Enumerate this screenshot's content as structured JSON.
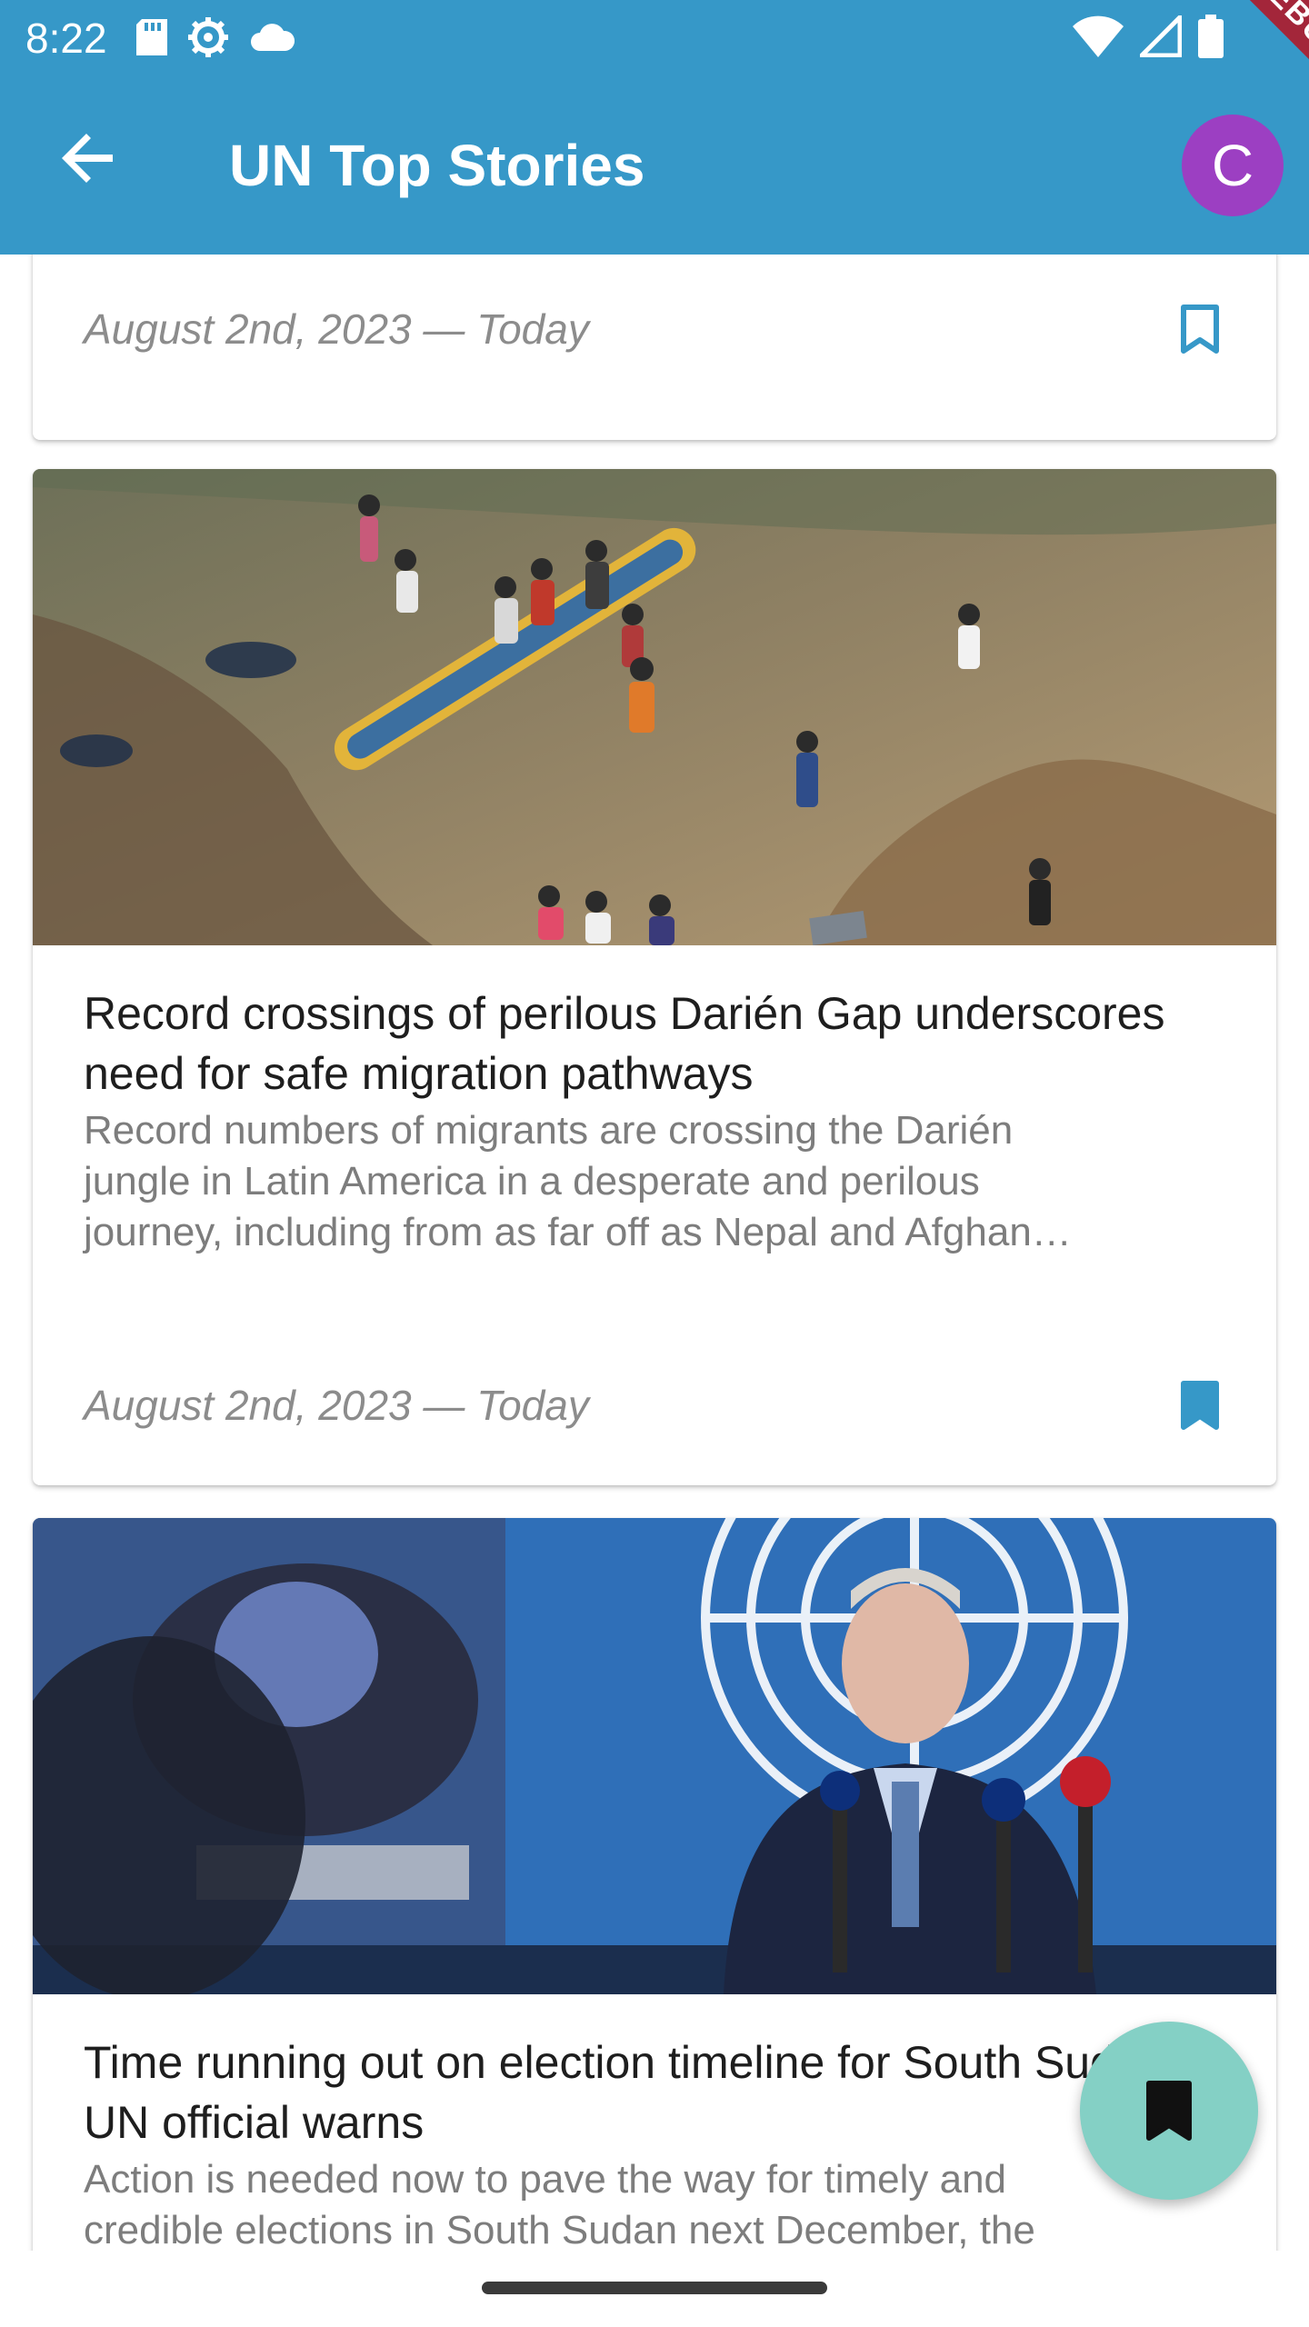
{
  "status_bar": {
    "time": "8:22",
    "left_icons": [
      "sd-card-icon",
      "settings-gear-icon",
      "cloud-icon"
    ],
    "right_icons": [
      "wifi-icon",
      "cell-signal-icon",
      "battery-icon"
    ]
  },
  "debug_banner": "DEBUG",
  "app_bar": {
    "title": "UN Top Stories",
    "avatar_letter": "C",
    "colors": {
      "background": "#3698c8",
      "avatar": "#9c3fc2"
    }
  },
  "stories": [
    {
      "date": "August 2nd, 2023 — Today",
      "bookmarked": false
    },
    {
      "image": "migrants-crossing-river-photo",
      "title": "Record crossings of perilous Darién Gap underscores need for safe migration pathways",
      "description": "Record numbers of migrants are crossing the Darién\njungle in Latin America in a desperate and perilous\njourney, including from as far off as Nepal and Afghan…",
      "date": "August 2nd, 2023 — Today",
      "bookmarked": true
    },
    {
      "image": "un-official-press-conference-photo",
      "title": "Time running out on election timeline for South Sudan, UN official warns",
      "description": "Action is needed now to pave the way for timely and\ncredible elections in South Sudan next December, the"
    }
  ],
  "fab": {
    "icon": "bookmark-icon",
    "color": "#84d0c5"
  }
}
